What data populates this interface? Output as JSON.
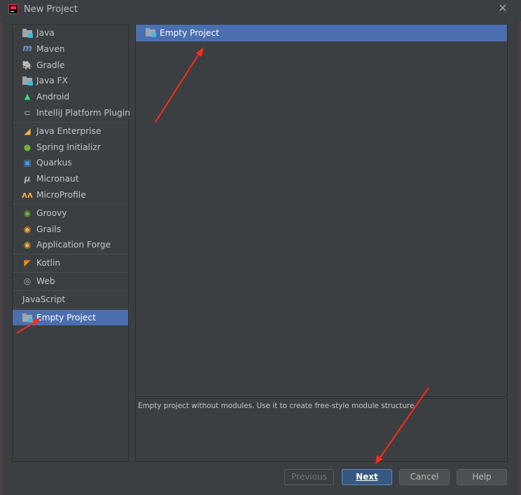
{
  "window": {
    "title": "New Project"
  },
  "sidebar": {
    "groups": [
      {
        "items": [
          {
            "label": "Java",
            "icon": "java-folder-icon"
          },
          {
            "label": "Maven",
            "icon": "maven-icon"
          },
          {
            "label": "Gradle",
            "icon": "gradle-icon"
          },
          {
            "label": "Java FX",
            "icon": "javafx-folder-icon"
          },
          {
            "label": "Android",
            "icon": "android-icon"
          },
          {
            "label": "IntelliJ Platform Plugin",
            "icon": "plugin-icon"
          }
        ]
      },
      {
        "items": [
          {
            "label": "Java Enterprise",
            "icon": "java-enterprise-icon"
          },
          {
            "label": "Spring Initializr",
            "icon": "spring-icon"
          },
          {
            "label": "Quarkus",
            "icon": "quarkus-icon"
          },
          {
            "label": "Micronaut",
            "icon": "micronaut-icon"
          },
          {
            "label": "MicroProfile",
            "icon": "microprofile-icon"
          }
        ]
      },
      {
        "items": [
          {
            "label": "Groovy",
            "icon": "groovy-icon"
          },
          {
            "label": "Grails",
            "icon": "grails-icon"
          },
          {
            "label": "Application Forge",
            "icon": "application-forge-icon"
          }
        ]
      },
      {
        "items": [
          {
            "label": "Kotlin",
            "icon": "kotlin-icon"
          }
        ]
      },
      {
        "items": [
          {
            "label": "Web",
            "icon": "web-globe-icon"
          }
        ]
      },
      {
        "items": [
          {
            "label": "JavaScript",
            "icon": ""
          }
        ]
      },
      {
        "items": [
          {
            "label": "Empty Project",
            "icon": "empty-project-folder-icon",
            "selected": true
          }
        ]
      }
    ]
  },
  "main": {
    "items": [
      {
        "label": "Empty Project",
        "icon": "empty-project-folder-icon",
        "selected": true
      }
    ],
    "description": "Empty project without modules. Use it to create free-style module structure."
  },
  "buttons": {
    "previous": "Previous",
    "next": "Next",
    "cancel": "Cancel",
    "help": "Help"
  },
  "colors": {
    "background": "#3c3f41",
    "selection": "#4b6eaf",
    "text": "#bbbbbb",
    "annotation_arrow": "#ff2a1a"
  }
}
